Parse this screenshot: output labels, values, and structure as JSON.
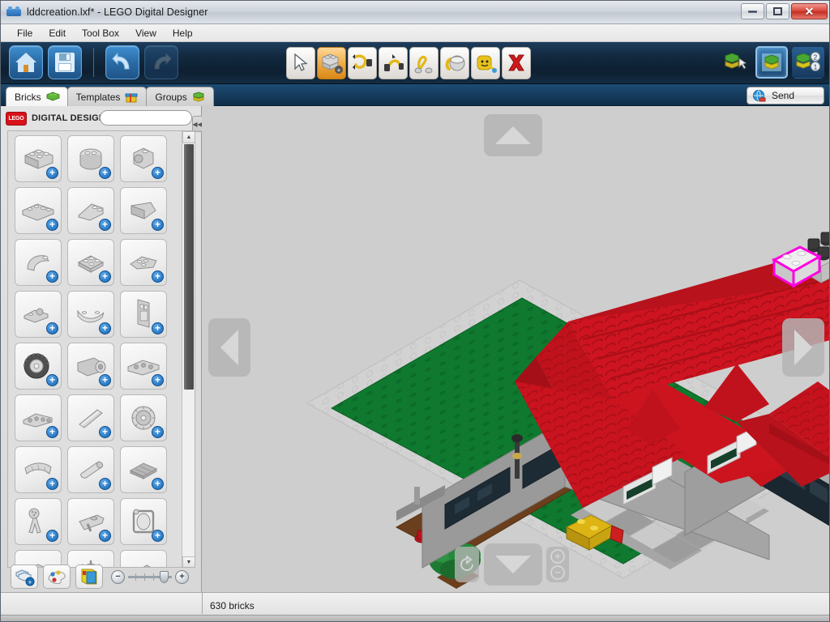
{
  "window": {
    "title": "lddcreation.lxf* - LEGO Digital Designer",
    "app_icon": "lego-brick-icon",
    "controls": {
      "minimize": "minimize-icon",
      "maximize": "maximize-icon",
      "close": "close-icon",
      "close_glyph": "✕"
    }
  },
  "menubar": {
    "items": [
      {
        "label": "File"
      },
      {
        "label": "Edit"
      },
      {
        "label": "Tool Box"
      },
      {
        "label": "View"
      },
      {
        "label": "Help"
      }
    ]
  },
  "toolbar": {
    "left": [
      {
        "name": "home-button",
        "icon": "home-icon",
        "tooltip": "Home"
      },
      {
        "name": "save-button",
        "icon": "floppy-disk-icon",
        "tooltip": "Save"
      },
      {
        "name": "undo-button",
        "icon": "undo-arrow-icon",
        "tooltip": "Undo",
        "enabled": true
      },
      {
        "name": "redo-button",
        "icon": "redo-arrow-icon",
        "tooltip": "Redo",
        "enabled": false
      }
    ],
    "tools": [
      {
        "name": "select-tool",
        "icon": "cursor-arrow-icon",
        "active": false
      },
      {
        "name": "clone-tool",
        "icon": "clone-brick-icon",
        "active": true
      },
      {
        "name": "hinge-tool",
        "icon": "hinge-rotate-icon",
        "active": false
      },
      {
        "name": "flex-tool",
        "icon": "hinge-align-icon",
        "active": false
      },
      {
        "name": "hinge-align-tool",
        "icon": "flex-tool-icon",
        "active": false
      },
      {
        "name": "paint-tool",
        "icon": "paint-bucket-icon",
        "active": false
      },
      {
        "name": "decorate-tool",
        "icon": "minifig-paint-icon",
        "active": false
      },
      {
        "name": "delete-tool",
        "icon": "red-x-delete-icon",
        "active": false
      }
    ],
    "modes": [
      {
        "name": "build-mode-button",
        "icon": "build-mode-icon",
        "selected": false
      },
      {
        "name": "view-mode-button",
        "icon": "view-mode-icon",
        "selected": true
      },
      {
        "name": "building-guide-button",
        "icon": "building-guide-icon",
        "selected": false,
        "badges": [
          "2",
          "1"
        ]
      }
    ]
  },
  "tabs": {
    "items": [
      {
        "label": "Bricks",
        "icon": "green-brick-icon",
        "active": true
      },
      {
        "label": "Templates",
        "icon": "template-box-icon",
        "active": false
      },
      {
        "label": "Groups",
        "icon": "brick-stack-icon",
        "active": false
      }
    ]
  },
  "send": {
    "label": "Send",
    "icon": "globe-upload-icon"
  },
  "palette": {
    "brand": "DIGITAL DESIGNER",
    "logo_text": "LEGO",
    "search": {
      "value": "",
      "placeholder": ""
    },
    "collapse_label": "◀◀",
    "scroll": {
      "up": "▲",
      "down": "▼",
      "thumb_top_pct": 3,
      "thumb_height_pct": 56
    },
    "bricks": [
      {
        "name": "brick-2x4",
        "shape": "brick"
      },
      {
        "name": "brick-round-2x2",
        "shape": "round"
      },
      {
        "name": "brick-headlight",
        "shape": "headlight"
      },
      {
        "name": "plate-1x4",
        "shape": "plate"
      },
      {
        "name": "slope-2x2",
        "shape": "slope"
      },
      {
        "name": "wedge-slope",
        "shape": "wedge"
      },
      {
        "name": "brick-curved-slope",
        "shape": "curved"
      },
      {
        "name": "plate-2x2",
        "shape": "plate2"
      },
      {
        "name": "wedge-plate",
        "shape": "wedgeplate"
      },
      {
        "name": "plate-with-clip",
        "shape": "clip"
      },
      {
        "name": "curved-panel",
        "shape": "panel"
      },
      {
        "name": "door-panel",
        "shape": "door"
      },
      {
        "name": "wheel-tire",
        "shape": "tire"
      },
      {
        "name": "motor-element",
        "shape": "motor"
      },
      {
        "name": "technic-beam",
        "shape": "beam"
      },
      {
        "name": "technic-liftarm",
        "shape": "liftarm"
      },
      {
        "name": "technic-axle",
        "shape": "axle"
      },
      {
        "name": "technic-gear",
        "shape": "gear"
      },
      {
        "name": "curved-wing",
        "shape": "wing"
      },
      {
        "name": "cylinder-tube",
        "shape": "tube"
      },
      {
        "name": "flat-tile-plate",
        "shape": "tile"
      },
      {
        "name": "wrench-element",
        "shape": "wrench"
      },
      {
        "name": "aircraft-fin",
        "shape": "fin"
      },
      {
        "name": "frame-element",
        "shape": "frame"
      },
      {
        "name": "bracket-plate",
        "shape": "bracket"
      },
      {
        "name": "ship-wheel",
        "shape": "shipwheel"
      },
      {
        "name": "ladder-element",
        "shape": "ladder"
      }
    ],
    "footer_buttons": [
      {
        "name": "brick-palette-filter-button",
        "icon": "brick-stack-plus-icon"
      },
      {
        "name": "color-palette-button",
        "icon": "color-palette-icon"
      },
      {
        "name": "box-catalog-button",
        "icon": "box-catalog-icon"
      }
    ],
    "zoom_slider": {
      "minus": "−",
      "plus": "+",
      "value_pct": 82
    }
  },
  "viewport": {
    "navigation": {
      "rotate_up": "up-arrow-icon",
      "rotate_down": "down-arrow-icon",
      "rotate_left": "left-arrow-icon",
      "rotate_right": "right-arrow-icon",
      "reset_view": "reset-rotation-icon",
      "zoom_in": "+",
      "zoom_out": "−"
    },
    "model": {
      "description": "LEGO house model with red roof",
      "selection_outline_color": "#ff00e0",
      "colors": {
        "roof_red": "#c8101a",
        "roof_red_dark": "#9e0c14",
        "roof_red_light": "#e01824",
        "wall_gray": "#9a9a9a",
        "wall_gray_light": "#b5b5b5",
        "lawn_green": "#0e7a2e",
        "lawn_green_light": "#139338",
        "baseplate_gray": "#d4d4d4",
        "patio_gray": "#a8a8a8",
        "soil_brown": "#6b3f1d",
        "chimney_black": "#2b2b2b",
        "window_dark": "#1c2b33",
        "flower_red": "#c0141c",
        "flower_yellow": "#e8b310",
        "vehicle_yellow": "#e0b410",
        "background": "#cecece"
      }
    }
  },
  "statusbar": {
    "text": "630 bricks"
  }
}
